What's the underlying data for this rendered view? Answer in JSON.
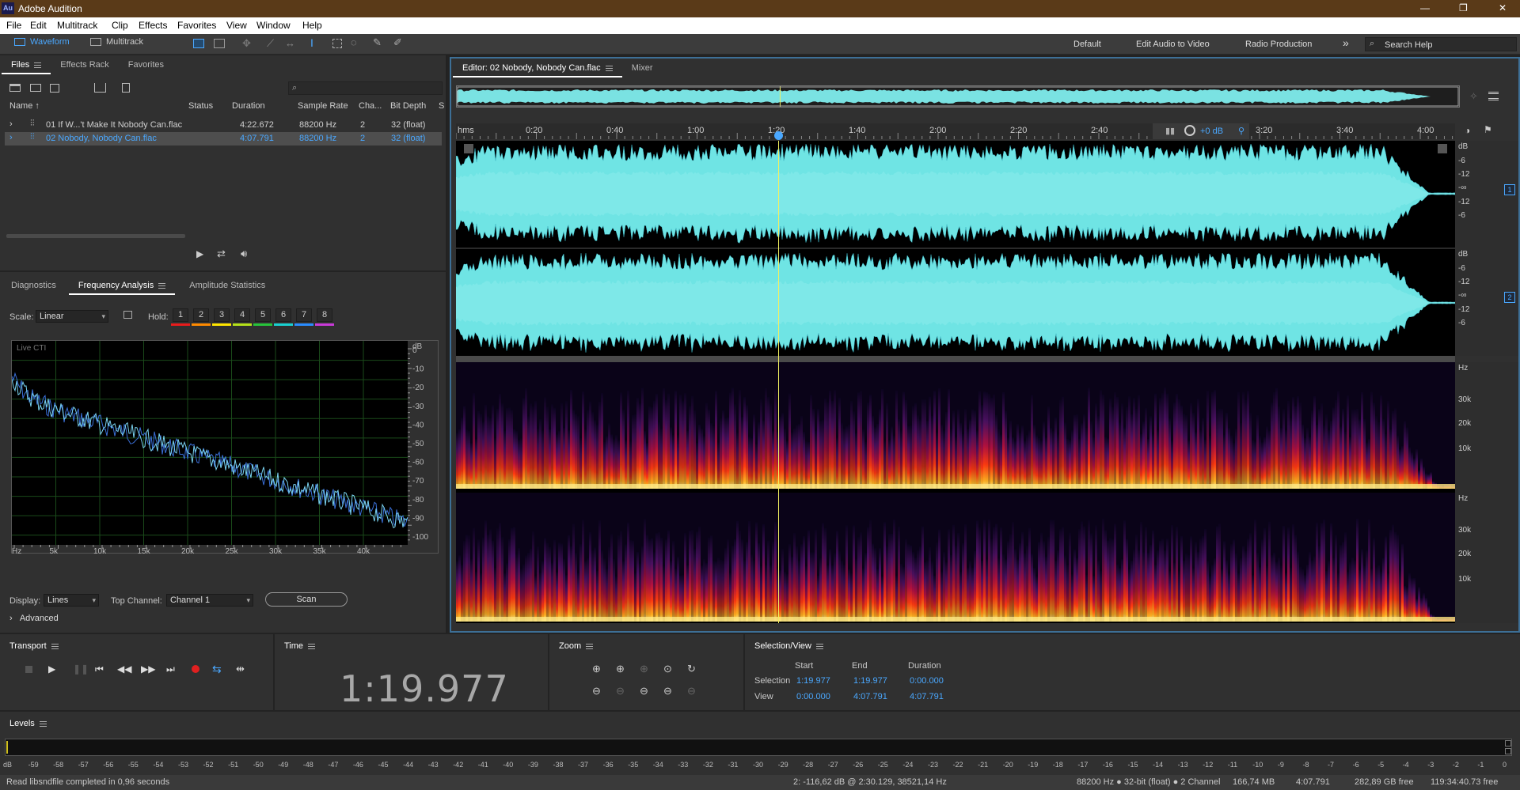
{
  "app": {
    "title": "Adobe Audition",
    "logo": "Au",
    "window_buttons": [
      "—",
      "❐",
      "✕"
    ]
  },
  "menu": [
    "File",
    "Edit",
    "Multitrack",
    "Clip",
    "Effects",
    "Favorites",
    "View",
    "Window",
    "Help"
  ],
  "toolbar": {
    "waveform": "Waveform",
    "multitrack": "Multitrack",
    "workspaces": [
      "Default",
      "Edit Audio to Video",
      "Radio Production"
    ],
    "more": "»",
    "search_placeholder": "Search Help"
  },
  "files_panel": {
    "tabs": [
      "Files",
      "Effects Rack",
      "Favorites"
    ],
    "columns": [
      "Name",
      "Status",
      "Duration",
      "Sample Rate",
      "Cha...",
      "Bit Depth",
      "S"
    ],
    "rows": [
      {
        "name": "01 If W...'t Make It Nobody Can.flac",
        "status": "",
        "duration": "4:22.672",
        "rate": "88200 Hz",
        "ch": "2",
        "bits": "32 (float)"
      },
      {
        "name": "02 Nobody, Nobody Can.flac",
        "status": "",
        "duration": "4:07.791",
        "rate": "88200 Hz",
        "ch": "2",
        "bits": "32 (float)"
      }
    ]
  },
  "analysis_panel": {
    "tabs": [
      "Diagnostics",
      "Frequency Analysis",
      "Amplitude Statistics"
    ],
    "scale_label": "Scale:",
    "scale_value": "Linear",
    "hold_label": "Hold:",
    "hold": [
      "1",
      "2",
      "3",
      "4",
      "5",
      "6",
      "7",
      "8"
    ],
    "hold_colors": [
      "#e81c1c",
      "#ff8a00",
      "#ffe600",
      "#b5e21a",
      "#27c43b",
      "#19d1d1",
      "#2a8cff",
      "#c93ad8"
    ],
    "live_cti": "Live CTI",
    "db_ticks": [
      "dB",
      "0",
      "-10",
      "-20",
      "-30",
      "-40",
      "-50",
      "-60",
      "-70",
      "-80",
      "-90",
      "-100"
    ],
    "hz_ticks": [
      "Hz",
      "5k",
      "10k",
      "15k",
      "20k",
      "25k",
      "30k",
      "35k",
      "40k"
    ],
    "display_label": "Display:",
    "display_value": "Lines",
    "top_channel_label": "Top Channel:",
    "top_channel_value": "Channel 1",
    "scan": "Scan",
    "advanced": "Advanced"
  },
  "editor": {
    "tabs": [
      "Editor: 02 Nobody, Nobody Can.flac",
      "Mixer"
    ],
    "ruler": [
      "hms",
      "0:20",
      "0:40",
      "1:00",
      "1:20",
      "1:40",
      "2:00",
      "2:20",
      "2:40",
      "3:20",
      "3:40",
      "4:00"
    ],
    "hud_gain": "+0 dB",
    "amp_labels_1": [
      "dB",
      "-6",
      "-12",
      "-∞",
      "-12",
      "-6"
    ],
    "amp_labels_2": [
      "dB",
      "-6",
      "-12",
      "-∞",
      "-12",
      "-6"
    ],
    "channel_1": "1",
    "channel_2": "2",
    "freq_labels_1": [
      "Hz",
      "30k",
      "20k",
      "10k"
    ],
    "freq_labels_2": [
      "Hz",
      "30k",
      "20k",
      "10k"
    ],
    "playhead_fraction": 0.3226
  },
  "transport": {
    "title": "Transport"
  },
  "time": {
    "title": "Time",
    "value": "1:19.977"
  },
  "zoom": {
    "title": "Zoom"
  },
  "selection_view": {
    "title": "Selection/View",
    "headers": [
      "Start",
      "End",
      "Duration"
    ],
    "rows": [
      {
        "label": "Selection",
        "start": "1:19.977",
        "end": "1:19.977",
        "duration": "0:00.000"
      },
      {
        "label": "View",
        "start": "0:00.000",
        "end": "4:07.791",
        "duration": "4:07.791"
      }
    ]
  },
  "levels": {
    "title": "Levels",
    "scale": [
      "dB",
      "-59",
      "-58",
      "-57",
      "-56",
      "-55",
      "-54",
      "-53",
      "-52",
      "-51",
      "-50",
      "-49",
      "-48",
      "-47",
      "-46",
      "-45",
      "-44",
      "-43",
      "-42",
      "-41",
      "-40",
      "-39",
      "-38",
      "-37",
      "-36",
      "-35",
      "-34",
      "-33",
      "-32",
      "-31",
      "-30",
      "-29",
      "-28",
      "-27",
      "-26",
      "-25",
      "-24",
      "-23",
      "-22",
      "-21",
      "-20",
      "-19",
      "-18",
      "-17",
      "-16",
      "-15",
      "-14",
      "-13",
      "-12",
      "-11",
      "-10",
      "-9",
      "-8",
      "-7",
      "-6",
      "-5",
      "-4",
      "-3",
      "-2",
      "-1",
      "0"
    ]
  },
  "status": {
    "left": "Read libsndfile completed in 0,96 seconds",
    "middle": "2: -116,62 dB @ 2:30.129, 38521,14 Hz",
    "format": "88200 Hz ● 32-bit (float) ● 2 Channel",
    "size": "166,74 MB",
    "duration": "4:07.791",
    "free": "282,89 GB free",
    "free_time": "119:34:40.73 free"
  }
}
